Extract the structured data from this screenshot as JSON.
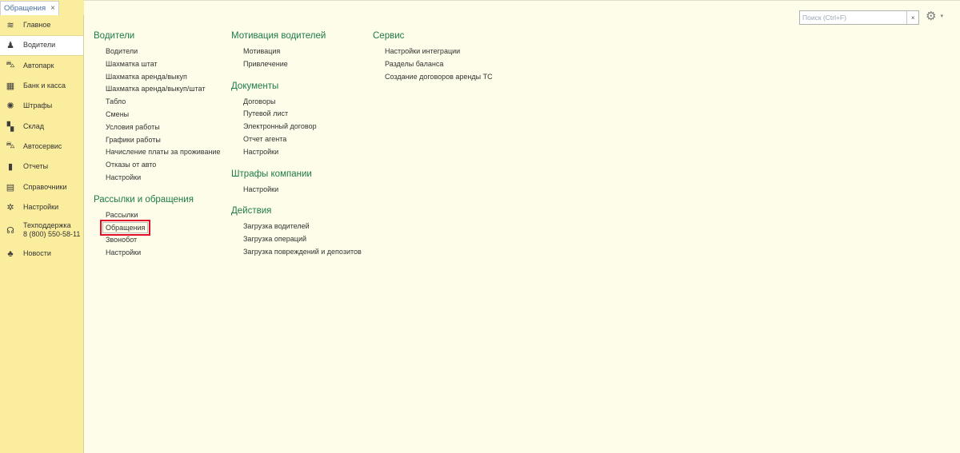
{
  "tab": {
    "label": "Обращения",
    "close": "×"
  },
  "sidebar": {
    "items": [
      {
        "label": "Главное",
        "icon": "main-icon",
        "glyph": "≋"
      },
      {
        "label": "Водители",
        "icon": "driver-icon",
        "glyph": "♟",
        "active": true
      },
      {
        "label": "Автопарк",
        "icon": "car-icon",
        "glyph": "⛍"
      },
      {
        "label": "Банк и касса",
        "icon": "bank-icon",
        "glyph": "▦"
      },
      {
        "label": "Штрафы",
        "icon": "fines-icon",
        "glyph": "✺"
      },
      {
        "label": "Склад",
        "icon": "warehouse-icon",
        "glyph": "▚"
      },
      {
        "label": "Автосервис",
        "icon": "autoservice-icon",
        "glyph": "⛍"
      },
      {
        "label": "Отчеты",
        "icon": "reports-icon",
        "glyph": "▮"
      },
      {
        "label": "Справочники",
        "icon": "directory-icon",
        "glyph": "▤"
      },
      {
        "label": "Настройки",
        "icon": "settings-icon",
        "glyph": "✲"
      },
      {
        "label": "Техподдержка\n8 (800) 550-58-11",
        "label1": "Техподдержка",
        "label2": "8 (800) 550-58-11",
        "icon": "headset-icon",
        "glyph": "☊"
      },
      {
        "label": "Новости",
        "icon": "bell-icon",
        "glyph": "♣"
      }
    ]
  },
  "search": {
    "placeholder": "Поиск (Ctrl+F)",
    "clear": "×"
  },
  "sections": {
    "col1": [
      {
        "title": "Водители",
        "items": [
          "Водители",
          "Шахматка штат",
          "Шахматка аренда/выкуп",
          "Шахматка аренда/выкуп/штат",
          "Табло",
          "Смены",
          "Условия работы",
          "Графики работы",
          "Начисление платы за проживание",
          "Отказы от авто",
          "Настройки"
        ]
      },
      {
        "title": "Рассылки и обращения",
        "items": [
          "Рассылки",
          "Обращения",
          "Звонобот",
          "Настройки"
        ]
      }
    ],
    "col2": [
      {
        "title": "Мотивация водителей",
        "items": [
          "Мотивация",
          "Привлечение"
        ]
      },
      {
        "title": "Документы",
        "items": [
          "Договоры",
          "Путевой лист",
          "Электронный договор",
          "Отчет агента",
          "Настройки"
        ]
      },
      {
        "title": "Штрафы компании",
        "items": [
          "Настройки"
        ]
      },
      {
        "title": "Действия",
        "items": [
          "Загрузка водителей",
          "Загрузка операций",
          "Загрузка повреждений и депозитов"
        ]
      }
    ],
    "col3": [
      {
        "title": "Сервис",
        "items": [
          "Настройки интеграции",
          "Разделы баланса",
          "Создание договоров аренды ТС"
        ]
      }
    ]
  },
  "highlighted_item": "Обращения",
  "colors": {
    "sidebar": "#fbed9e",
    "content": "#fdfde9",
    "group_title": "#1e7a4a",
    "highlight": "#e0102a"
  }
}
